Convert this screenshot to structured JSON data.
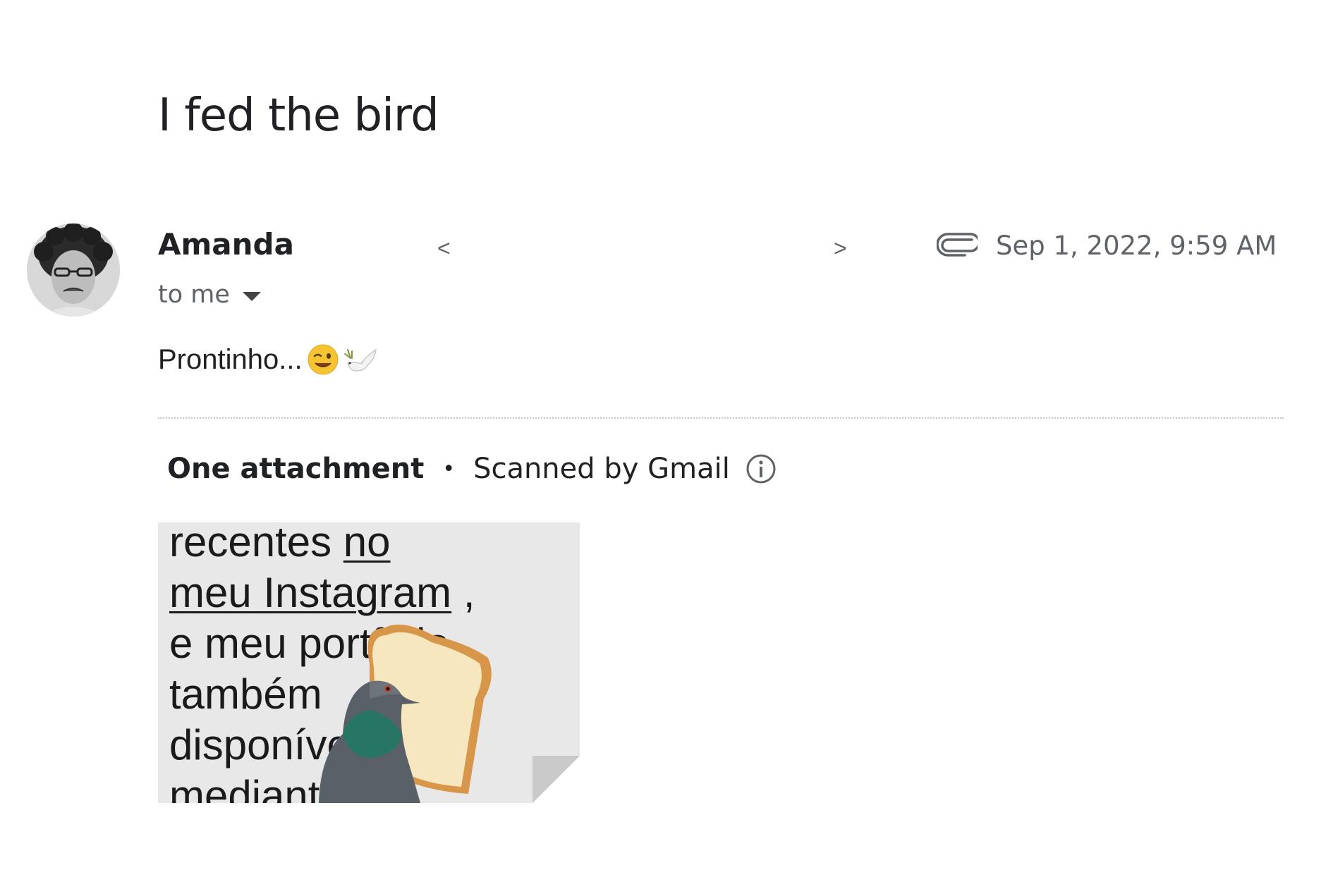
{
  "email": {
    "subject": "I fed the bird",
    "sender": {
      "name": "Amanda",
      "address_open": "<",
      "address_close": ">",
      "recipient_label": "to me"
    },
    "date": "Sep 1, 2022, 9:59 AM",
    "body_text": "Prontinho...",
    "body_emojis": [
      "winking-face",
      "dove-with-olive-branch"
    ]
  },
  "attachments": {
    "count_label": "One attachment",
    "separator": "•",
    "scan_label": "Scanned by Gmail",
    "thumbnail": {
      "lines": [
        "recentes ",
        "no",
        "meu Instagram",
        " ,",
        "e meu portfólio",
        "também",
        "disponível",
        "mediante"
      ]
    }
  },
  "icons": {
    "attachment": "paperclip-icon",
    "details": "chevron-down-icon",
    "info": "info-icon"
  },
  "colors": {
    "text": "#202124",
    "secondary": "#5f6368",
    "thumb_bg": "#e8e8e8"
  }
}
